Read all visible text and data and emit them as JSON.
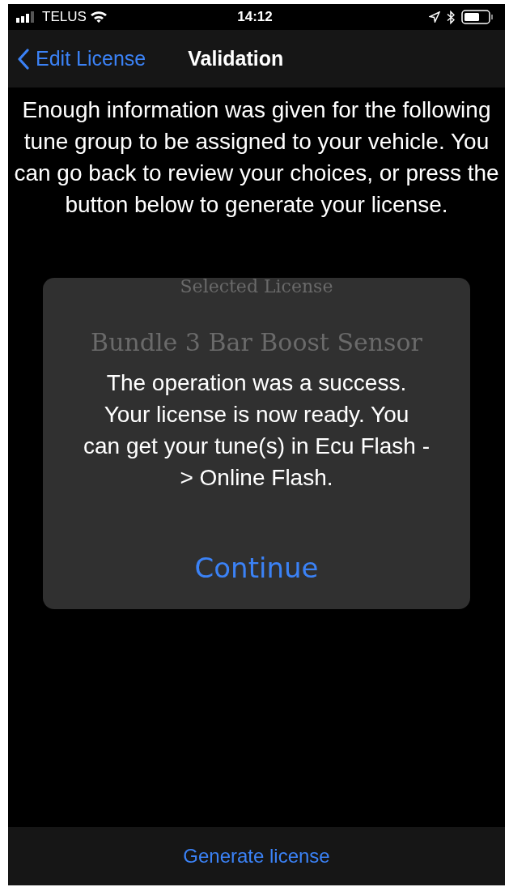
{
  "status_bar": {
    "carrier": "TELUS",
    "time": "14:12"
  },
  "nav_bar": {
    "back_label": "Edit License",
    "title": "Validation"
  },
  "message": "Enough information was given for the following tune group to be assigned to your vehicle. You can go back to review your choices, or press the button below to generate your license.",
  "background_texts": [
    {
      "kind": "label",
      "text": "Selected License"
    },
    {
      "kind": "value",
      "text": "Bundle 3 Bar Boost Sensor"
    }
  ],
  "alert": {
    "message": "The operation was a success. Your license is now ready. You can get your tune(s) in Ecu Flash -> Online Flash.",
    "button": "Continue"
  },
  "bottom_button": "Generate license"
}
